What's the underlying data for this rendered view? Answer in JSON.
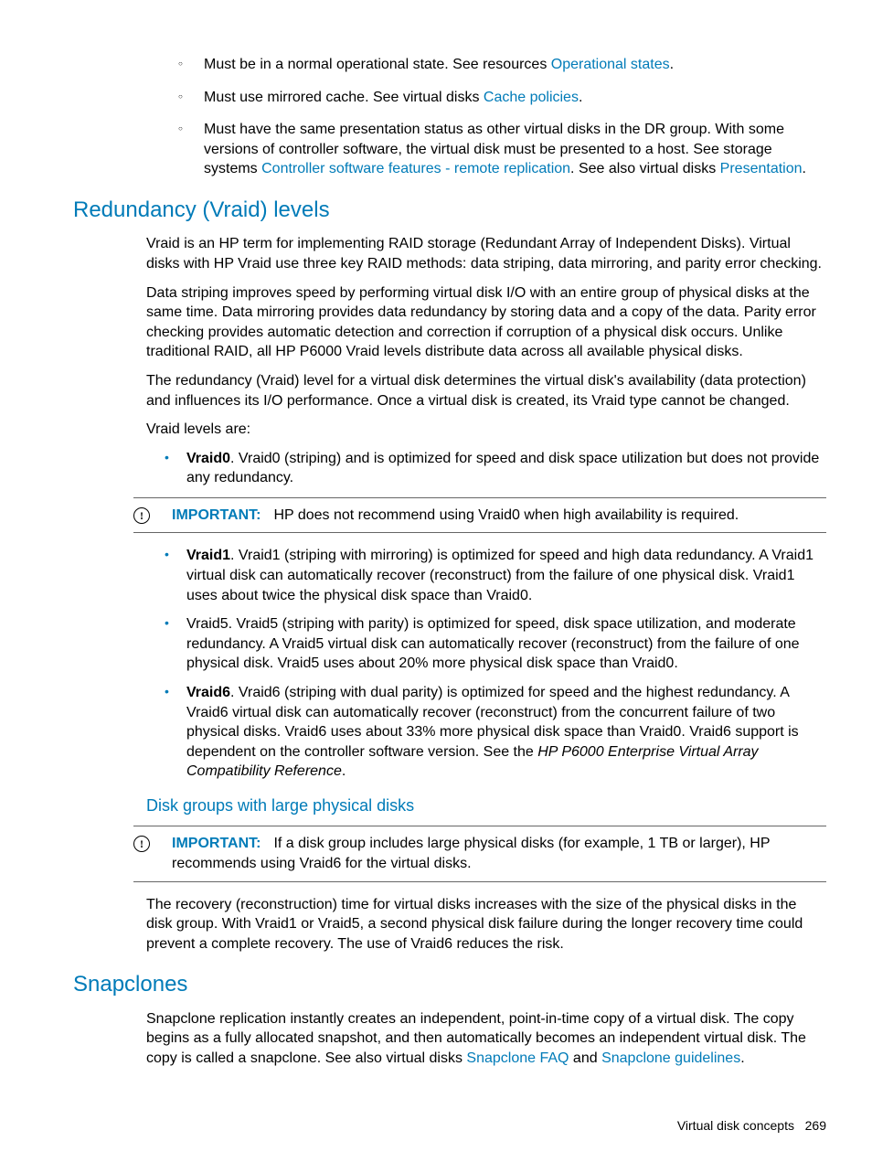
{
  "sublist": {
    "b1": {
      "text": "Must be in a normal operational state. See resources ",
      "link": "Operational states",
      "tail": "."
    },
    "b2": {
      "text": "Must use mirrored cache. See virtual disks ",
      "link": "Cache policies",
      "tail": "."
    },
    "b3": {
      "text": "Must have the same presentation status as other virtual disks in the DR group. With some versions of controller software, the virtual disk must be presented to a host. See storage systems ",
      "link1": "Controller software features - remote replication",
      "mid": ". See also virtual disks ",
      "link2": "Presentation",
      "tail": "."
    }
  },
  "sec1": {
    "title": "Redundancy (Vraid) levels",
    "p1": "Vraid is an HP term for implementing RAID storage (Redundant Array of Independent Disks). Virtual disks with HP Vraid use three key RAID methods: data striping, data mirroring, and parity error checking.",
    "p2": "Data striping improves speed by performing virtual disk I/O with an entire group of physical disks at the same time. Data mirroring provides data redundancy by storing data and a copy of the data. Parity error checking provides automatic detection and correction if corruption of a physical disk occurs. Unlike traditional RAID, all HP P6000 Vraid levels distribute data across all available physical disks.",
    "p3": "The redundancy (Vraid) level for a virtual disk determines the virtual disk's availability (data protection) and influences its I/O performance. Once a virtual disk is created, its Vraid type cannot be changed.",
    "p4": "Vraid levels are:",
    "v0": {
      "label": "Vraid0",
      "text": ". Vraid0 (striping) and is optimized for speed and disk space utilization but does not provide any redundancy."
    },
    "imp1": {
      "label": "IMPORTANT:",
      "text": "HP does not recommend using Vraid0 when high availability is required."
    },
    "v1": {
      "label": "Vraid1",
      "text": ". Vraid1 (striping with mirroring) is optimized for speed and high data redundancy. A Vraid1 virtual disk can automatically recover (reconstruct) from the failure of one physical disk. Vraid1 uses about twice the physical disk space than Vraid0."
    },
    "v5": {
      "text": "Vraid5. Vraid5 (striping with parity) is optimized for speed, disk space utilization, and moderate redundancy. A Vraid5 virtual disk can automatically recover (reconstruct) from the failure of one physical disk. Vraid5 uses about 20% more physical disk space than Vraid0."
    },
    "v6": {
      "label": "Vraid6",
      "text1": ". Vraid6 (striping with dual parity) is optimized for speed and the highest redundancy. A Vraid6 virtual disk can automatically recover (reconstruct) from the concurrent failure of two physical disks. Vraid6 uses about 33% more physical disk space than Vraid0. Vraid6 support is dependent on the controller software version. See the ",
      "italic": "HP P6000 Enterprise Virtual Array Compatibility Reference",
      "text2": "."
    },
    "sub": {
      "title": "Disk groups with large physical disks",
      "imp2": {
        "label": "IMPORTANT:",
        "text": "If a disk group includes large physical disks (for example, 1 TB or larger), HP recommends using Vraid6 for the virtual disks."
      },
      "p1": "The recovery (reconstruction) time for virtual disks increases with the size of the physical disks in the disk group. With Vraid1 or Vraid5, a second physical disk failure during the longer recovery time could prevent a complete recovery. The use of Vraid6 reduces the risk."
    }
  },
  "sec2": {
    "title": "Snapclones",
    "p1a": "Snapclone replication instantly creates an independent, point-in-time copy of a virtual disk. The copy begins as a fully allocated snapshot, and then automatically becomes an independent virtual disk. The copy is called a snapclone. See also virtual disks ",
    "link1": "Snapclone FAQ",
    "p1b": " and ",
    "link2": "Snapclone guidelines",
    "p1c": "."
  },
  "footer": {
    "section": "Virtual disk concepts",
    "page": "269"
  }
}
